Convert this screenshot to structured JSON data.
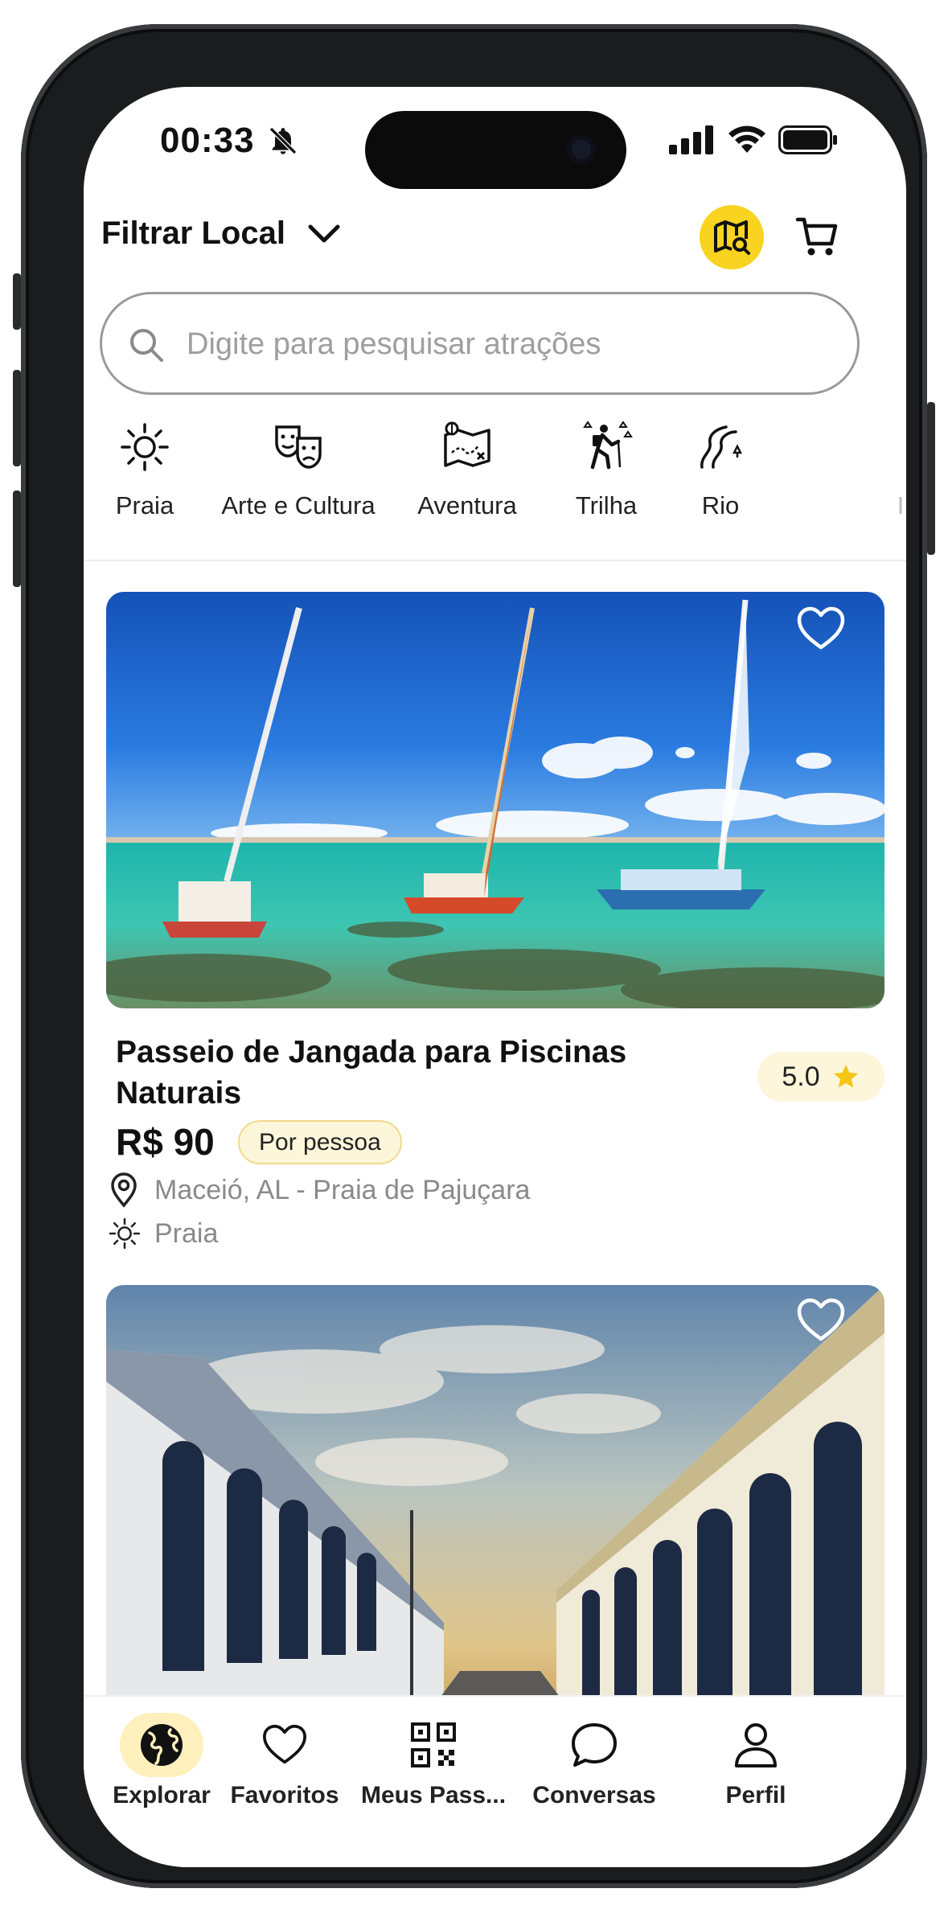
{
  "status_bar": {
    "time": "00:33"
  },
  "header": {
    "filter_label": "Filtrar Local"
  },
  "search": {
    "placeholder": "Digite para pesquisar atrações"
  },
  "categories": [
    {
      "label": "Praia",
      "icon": "sun-icon"
    },
    {
      "label": "Arte e Cultura",
      "icon": "theater-masks-icon"
    },
    {
      "label": "Aventura",
      "icon": "treasure-map-icon"
    },
    {
      "label": "Trilha",
      "icon": "hiker-icon"
    },
    {
      "label": "Rio",
      "icon": "river-icon"
    }
  ],
  "cards": [
    {
      "title": "Passeio de Jangada para Piscinas Naturais",
      "rating": "5.0",
      "price": "R$ 90",
      "price_unit": "Por pessoa",
      "location": "Maceió, AL - Praia de Pajuçara",
      "category": "Praia",
      "image": "jangada-boats-photo"
    },
    {
      "image": "historic-street-photo"
    }
  ],
  "tabbar": [
    {
      "label": "Explorar",
      "icon": "globe-icon",
      "active": true
    },
    {
      "label": "Favoritos",
      "icon": "heart-icon",
      "active": false
    },
    {
      "label": "Meus Pass...",
      "icon": "qr-code-icon",
      "active": false
    },
    {
      "label": "Conversas",
      "icon": "chat-bubble-icon",
      "active": false
    },
    {
      "label": "Perfil",
      "icon": "person-icon",
      "active": false
    }
  ],
  "colors": {
    "accent_yellow": "#f8d320",
    "chip_bg": "#fdf6da",
    "star": "#f5c518",
    "muted_text": "#8a8a8a"
  }
}
